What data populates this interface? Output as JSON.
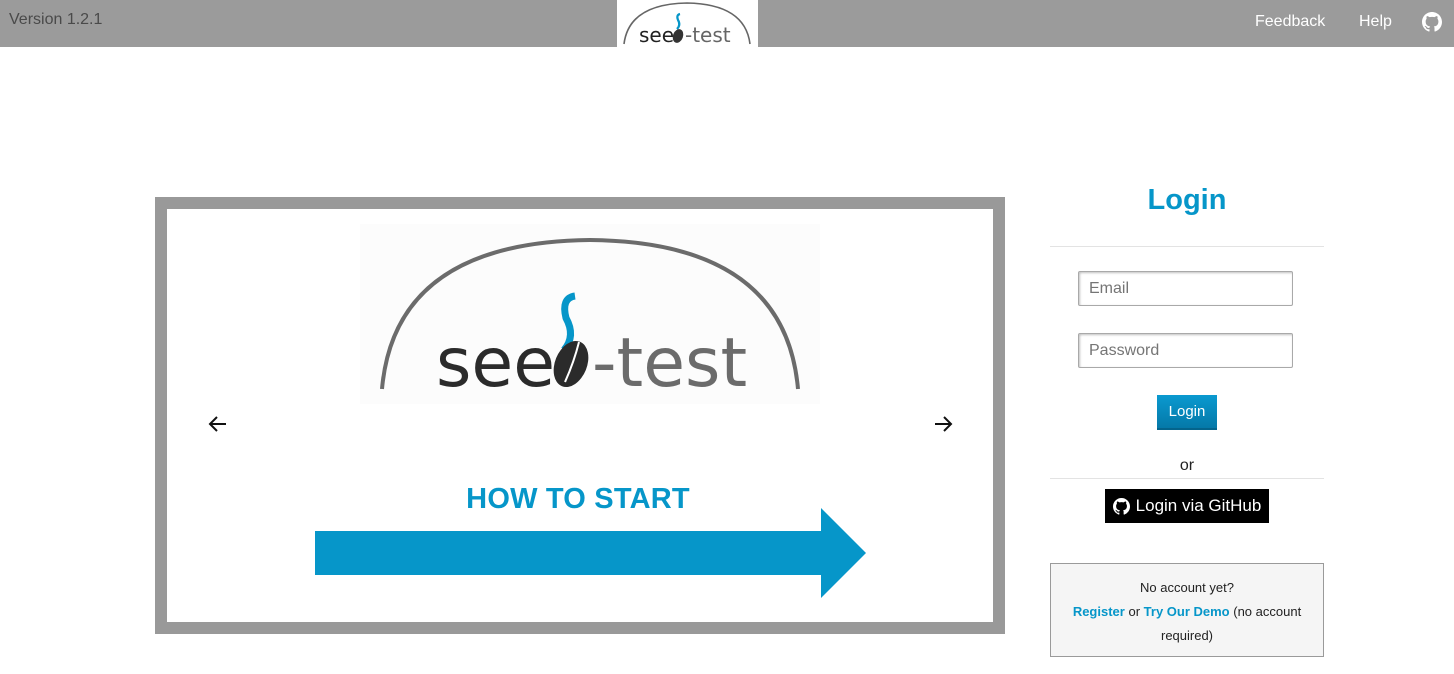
{
  "header": {
    "version": "Version 1.2.1",
    "logo_text_left": "see",
    "logo_text_right": "-test",
    "nav": {
      "feedback": "Feedback",
      "help": "Help",
      "github_icon": "github-icon"
    }
  },
  "carousel": {
    "slide_logo_left": "see",
    "slide_logo_right": "-test",
    "heading": "HOW TO START",
    "prev_icon": "arrow-left-icon",
    "next_icon": "arrow-right-icon"
  },
  "login": {
    "title": "Login",
    "email_placeholder": "Email",
    "password_placeholder": "Password",
    "submit_label": "Login",
    "or_text": "or",
    "github_label": "Login via GitHub",
    "no_account": "No account yet?",
    "register": "Register",
    "or_inline": "or",
    "demo": "Try Our Demo",
    "demo_note": "(no account required)"
  },
  "colors": {
    "accent": "#0696c9",
    "topbar": "#9b9b9b",
    "carousel_border": "#999999"
  }
}
